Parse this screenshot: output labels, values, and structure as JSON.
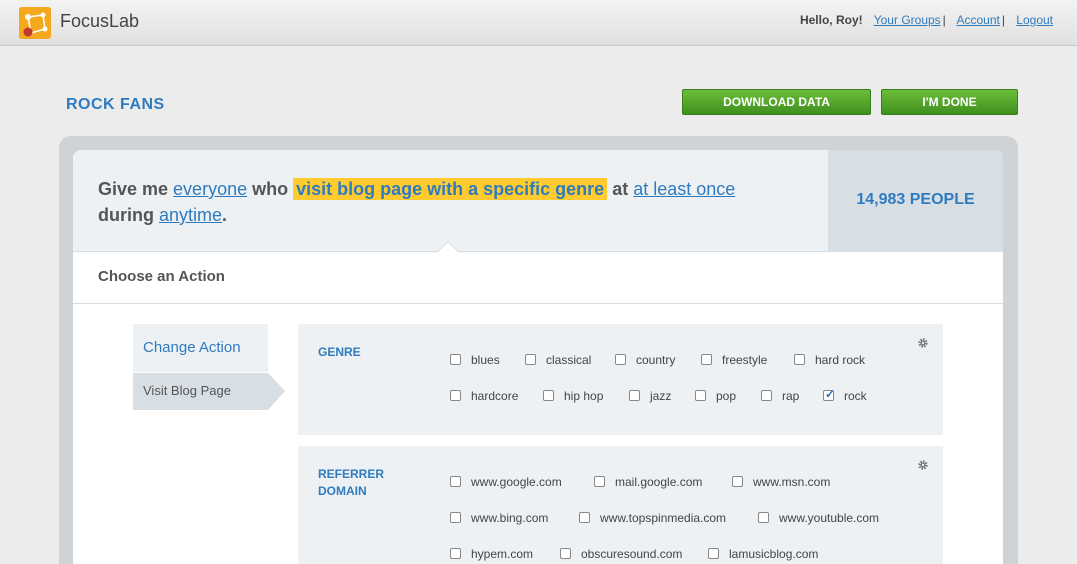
{
  "app": {
    "name": "FocusLab",
    "greeting": "Hello, Roy!",
    "nav": [
      "Your Groups",
      "Account",
      "Logout"
    ]
  },
  "page": {
    "title": "ROCK FANS",
    "download_label": "DOWNLOAD DATA",
    "done_label": "I'M DONE"
  },
  "query": {
    "prefix": "Give me ",
    "audience": "everyone",
    "who": " who ",
    "condition": "visit blog page with a specific genre",
    "at": " at ",
    "frequency": "at least once",
    "during": "during ",
    "timeframe": "anytime",
    "period": ".",
    "count": "14,983 PEOPLE"
  },
  "action": {
    "heading": "Choose an Action",
    "menu": [
      "Change Action",
      "Visit Blog Page"
    ]
  },
  "filters": {
    "genre": {
      "label": "GENRE",
      "options": [
        {
          "label": "blues",
          "checked": false
        },
        {
          "label": "classical",
          "checked": false
        },
        {
          "label": "country",
          "checked": false
        },
        {
          "label": "freestyle",
          "checked": false
        },
        {
          "label": "hard rock",
          "checked": false
        },
        {
          "label": "hardcore",
          "checked": false
        },
        {
          "label": "hip hop",
          "checked": false
        },
        {
          "label": "jazz",
          "checked": false
        },
        {
          "label": "pop",
          "checked": false
        },
        {
          "label": "rap",
          "checked": false
        },
        {
          "label": "rock",
          "checked": true
        }
      ]
    },
    "referrer": {
      "label": "REFERRER DOMAIN",
      "options": [
        {
          "label": "www.google.com",
          "checked": false
        },
        {
          "label": "mail.google.com",
          "checked": false
        },
        {
          "label": "www.msn.com",
          "checked": false
        },
        {
          "label": "www.bing.com",
          "checked": false
        },
        {
          "label": "www.topspinmedia.com",
          "checked": false
        },
        {
          "label": "www.youtuble.com",
          "checked": false
        },
        {
          "label": "hypem.com",
          "checked": false
        },
        {
          "label": "obscuresound.com",
          "checked": false
        },
        {
          "label": "lamusicblog.com",
          "checked": false
        }
      ]
    }
  },
  "colors": {
    "accent": "#2f7bbf",
    "highlight": "#ffcb2f",
    "button": "#4fa02a"
  }
}
